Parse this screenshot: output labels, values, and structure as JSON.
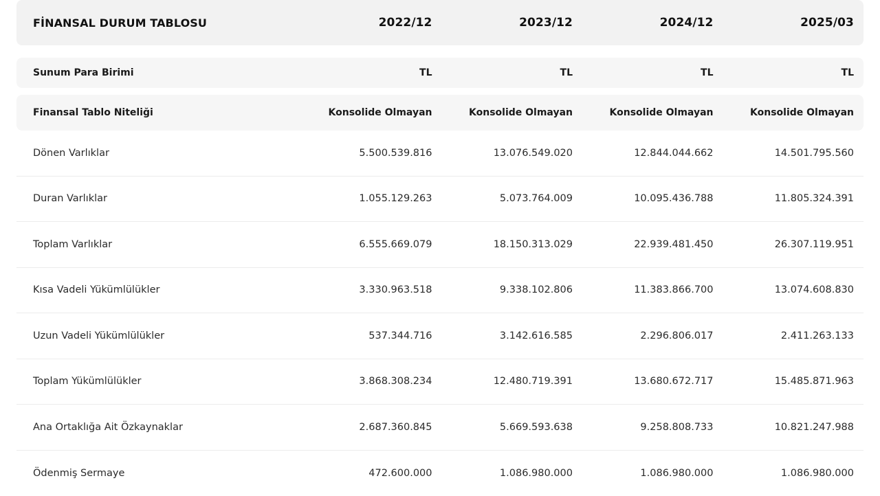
{
  "table": {
    "title": "FİNANSAL DURUM TABLOSU",
    "periods": [
      "2022/12",
      "2023/12",
      "2024/12",
      "2025/03"
    ],
    "currency": {
      "label": "Sunum Para Birimi",
      "values": [
        "TL",
        "TL",
        "TL",
        "TL"
      ]
    },
    "nature": {
      "label": "Finansal Tablo Niteliği",
      "values": [
        "Konsolide Olmayan",
        "Konsolide Olmayan",
        "Konsolide Olmayan",
        "Konsolide Olmayan"
      ]
    },
    "rows": [
      {
        "label": "Dönen Varlıklar",
        "values": [
          "5.500.539.816",
          "13.076.549.020",
          "12.844.044.662",
          "14.501.795.560"
        ]
      },
      {
        "label": "Duran Varlıklar",
        "values": [
          "1.055.129.263",
          "5.073.764.009",
          "10.095.436.788",
          "11.805.324.391"
        ]
      },
      {
        "label": "Toplam Varlıklar",
        "values": [
          "6.555.669.079",
          "18.150.313.029",
          "22.939.481.450",
          "26.307.119.951"
        ]
      },
      {
        "label": "Kısa Vadeli Yükümlülükler",
        "values": [
          "3.330.963.518",
          "9.338.102.806",
          "11.383.866.700",
          "13.074.608.830"
        ]
      },
      {
        "label": "Uzun Vadeli Yükümlülükler",
        "values": [
          "537.344.716",
          "3.142.616.585",
          "2.296.806.017",
          "2.411.263.133"
        ]
      },
      {
        "label": "Toplam Yükümlülükler",
        "values": [
          "3.868.308.234",
          "12.480.719.391",
          "13.680.672.717",
          "15.485.871.963"
        ]
      },
      {
        "label": "Ana Ortaklığa Ait Özkaynaklar",
        "values": [
          "2.687.360.845",
          "5.669.593.638",
          "9.258.808.733",
          "10.821.247.988"
        ]
      },
      {
        "label": "Ödenmiş Sermaye",
        "values": [
          "472.600.000",
          "1.086.980.000",
          "1.086.980.000",
          "1.086.980.000"
        ]
      }
    ]
  }
}
